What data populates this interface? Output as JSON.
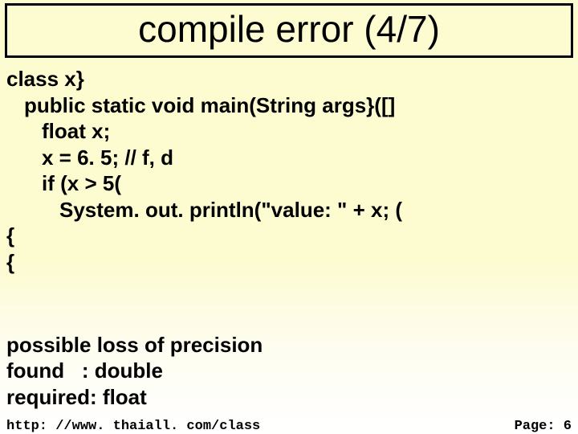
{
  "title": "compile error (4/7)",
  "code": {
    "l1": "class x}",
    "l2": "public static void main(String args}([]",
    "l3": "float x;",
    "l4": "x = 6. 5; // f, d",
    "l5": "if (x > 5(",
    "l6": "System. out. println(\"value: \" + x; (",
    "l7": "{",
    "l8": "{"
  },
  "error": {
    "e1": "possible loss of precision",
    "e2": "found   : double",
    "e3": "required: float"
  },
  "footer": {
    "url": "http: //www. thaiall. com/class",
    "page_label": "Page:  6"
  }
}
